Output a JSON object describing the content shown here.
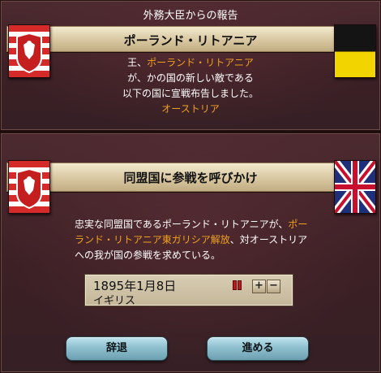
{
  "top_panel": {
    "title": "外務大臣からの報告",
    "banner": "ポーランド・リトアニア",
    "line1_prefix": "王、",
    "line1_country": "ポーランド・リトアニア",
    "line2": "が、かの国の新しい敵である",
    "line3": "以下の国に宣戦布告しました。",
    "enemy": "オーストリア"
  },
  "bottom_panel": {
    "banner": "同盟国に参戦を呼びかけ",
    "msg_part1": "忠実な同盟国であるポーランド・リトアニアが、",
    "msg_war": "ポーランド・リトアニア東ガリシア解放",
    "msg_part2": "、対オーストリアへの我が国の参戦を求めている。"
  },
  "date_widget": {
    "date": "1895年1月8日",
    "country": "イギリス",
    "plus": "+",
    "minus": "−"
  },
  "buttons": {
    "decline": "辞退",
    "proceed": "進める"
  },
  "flags": {
    "poland": "poland-lithuania-flag",
    "austria": "austria-flag",
    "uk": "united-kingdom-flag"
  },
  "colors": {
    "highlight": "#f0a020",
    "panel_bg": "#3c2025",
    "button": "#8fc0cf"
  }
}
